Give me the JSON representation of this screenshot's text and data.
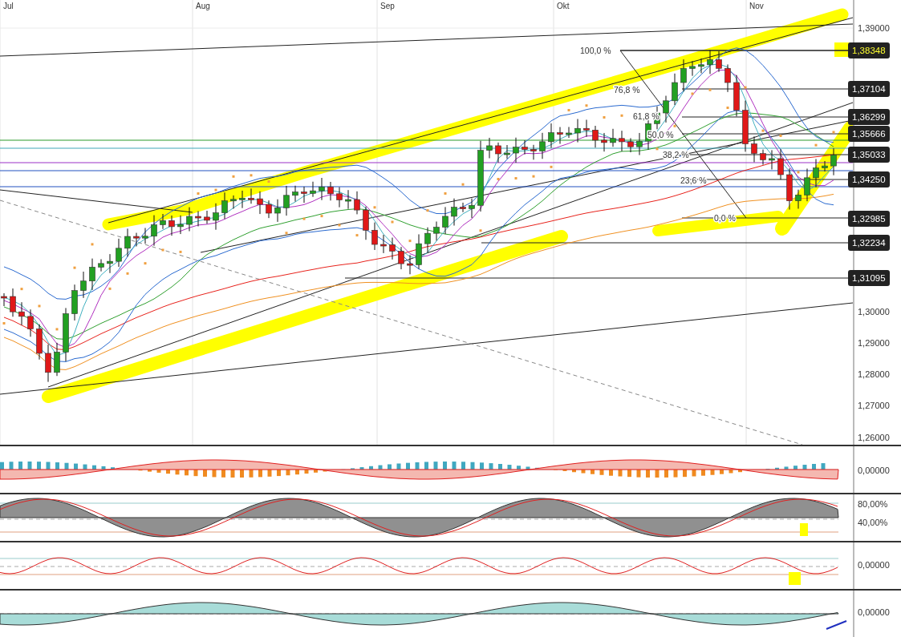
{
  "x_axis": {
    "months": [
      "Jul",
      "Aug",
      "Sep",
      "Okt",
      "Nov"
    ]
  },
  "price_panel": {
    "axis_ticks": [
      "1,39000",
      "1,30000",
      "1,29000",
      "1,28000",
      "1,27000",
      "1,26000"
    ],
    "price_tags": [
      {
        "text": "1,38348",
        "highlighted": true
      },
      {
        "text": "1,37104",
        "highlighted": false
      },
      {
        "text": "1,36299",
        "highlighted": false
      },
      {
        "text": "1,35666",
        "highlighted": false
      },
      {
        "text": "1,35033",
        "highlighted": false
      },
      {
        "text": "1,34250",
        "highlighted": false
      },
      {
        "text": "1,32985",
        "highlighted": false
      },
      {
        "text": "1,32234",
        "highlighted": false
      },
      {
        "text": "1,31095",
        "highlighted": false
      }
    ],
    "fibonacci_levels": [
      "100,0 %",
      "76,8 %",
      "61,8 %",
      "50,0 %",
      "38,2 %",
      "23,6 %",
      "0,0 %"
    ]
  },
  "indicator_panels": [
    {
      "kind": "macd",
      "axis_labels": [
        "0,00000"
      ]
    },
    {
      "kind": "stochastic",
      "axis_labels": [
        "80,00%",
        "40,00%"
      ]
    },
    {
      "kind": "momentum",
      "axis_labels": [
        "0,00000"
      ]
    },
    {
      "kind": "area",
      "axis_labels": [
        "0,00000"
      ]
    }
  ]
}
